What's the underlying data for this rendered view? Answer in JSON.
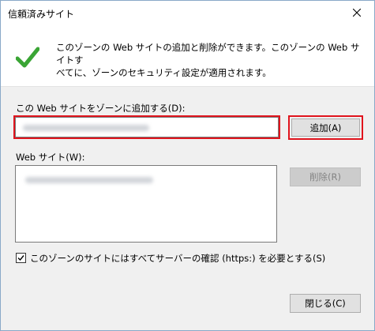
{
  "window": {
    "title": "信頼済みサイト"
  },
  "info": {
    "icon": "checkmark-icon",
    "line1": "このゾーンの Web サイトの追加と削除ができます。このゾーンの Web サイトす",
    "line2": "べてに、ゾーンのセキュリティ設定が適用されます。"
  },
  "add_site": {
    "label": "この Web サイトをゾーンに追加する(D):",
    "button": "追加(A)"
  },
  "websites": {
    "label": "Web サイト(W):",
    "remove_button": "削除(R)"
  },
  "https_option": {
    "label": "このゾーンのサイトにはすべてサーバーの確認 (https:) を必要とする(S)",
    "checked": true
  },
  "footer": {
    "close_button": "閉じる(C)"
  },
  "colors": {
    "highlight": "#e0141d",
    "check": "#3aa535"
  }
}
